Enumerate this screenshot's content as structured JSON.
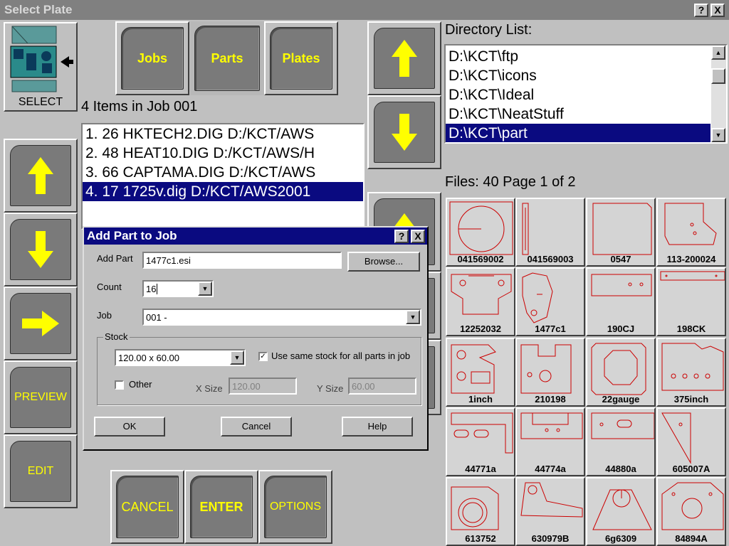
{
  "window": {
    "title": "Select Plate",
    "help_label": "?",
    "close_label": "X"
  },
  "select_tool": {
    "label": "SELECT"
  },
  "tabs": [
    {
      "label": "Jobs"
    },
    {
      "label": "Parts"
    },
    {
      "label": "Plates"
    }
  ],
  "job_items": {
    "heading": "4 Items in Job 001",
    "rows": [
      "1.  26 HKTECH2.DIG    D:/KCT/AWS",
      "2.  48 HEAT10.DIG    D:/KCT/AWS/H",
      "3.  66 CAPTAMA.DIG    D:/KCT/AWS",
      "4.  17 1725v.dig    D:/KCT/AWS2001"
    ],
    "selected_index": 3
  },
  "side_buttons": {
    "preview": "PREVIEW",
    "edit": "EDIT"
  },
  "bottom_buttons": {
    "cancel": "CANCEL",
    "enter": "ENTER",
    "options": "OPTIONS"
  },
  "directory": {
    "heading": "Directory List:",
    "items": [
      "D:\\KCT\\ftp",
      "D:\\KCT\\icons",
      "D:\\KCT\\Ideal",
      "D:\\KCT\\NeatStuff",
      "D:\\KCT\\part"
    ],
    "selected_index": 4
  },
  "files": {
    "heading": "Files: 40 Page 1 of 2",
    "items": [
      "041569002",
      "041569003",
      "0547",
      "113-200024",
      "12252032",
      "1477c1",
      "190CJ",
      "198CK",
      "1inch",
      "210198",
      "22gauge",
      "375inch",
      "44771a",
      "44774a",
      "44880a",
      "605007A",
      "613752",
      "630979B",
      "6g6309",
      "84894A"
    ]
  },
  "dialog": {
    "title": "Add Part to Job",
    "help_label": "?",
    "close_label": "X",
    "add_part_label": "Add Part",
    "add_part_value": "1477c1.esi",
    "browse_label": "Browse...",
    "count_label": "Count",
    "count_value": "16",
    "job_label": "Job",
    "job_value": "001 -",
    "stock_group": "Stock",
    "stock_value": "120.00 x 60.00",
    "same_stock_label": "Use same stock for all parts in job",
    "same_stock_checked": true,
    "other_label": "Other",
    "other_checked": false,
    "xsize_label": "X Size",
    "xsize_value": "120.00",
    "ysize_label": "Y Size",
    "ysize_value": "60.00",
    "ok_label": "OK",
    "cancel_label": "Cancel",
    "help_button_label": "Help"
  },
  "colors": {
    "accent": "#ffff00",
    "selection": "#0a0a80",
    "part_outline": "#cc0000"
  }
}
